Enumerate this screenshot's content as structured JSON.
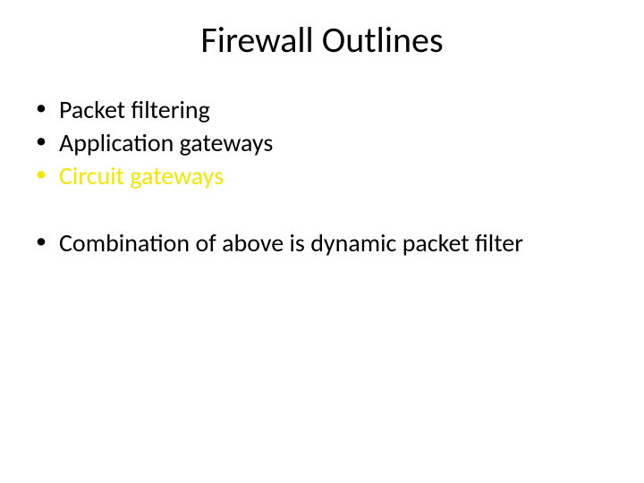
{
  "title": "Firewall Outlines",
  "bullets": {
    "b1": "Packet filtering",
    "b2": "Application gateways",
    "b3": "Circuit gateways",
    "b4": "Combination of above is dynamic packet filter"
  },
  "glyph": "•"
}
